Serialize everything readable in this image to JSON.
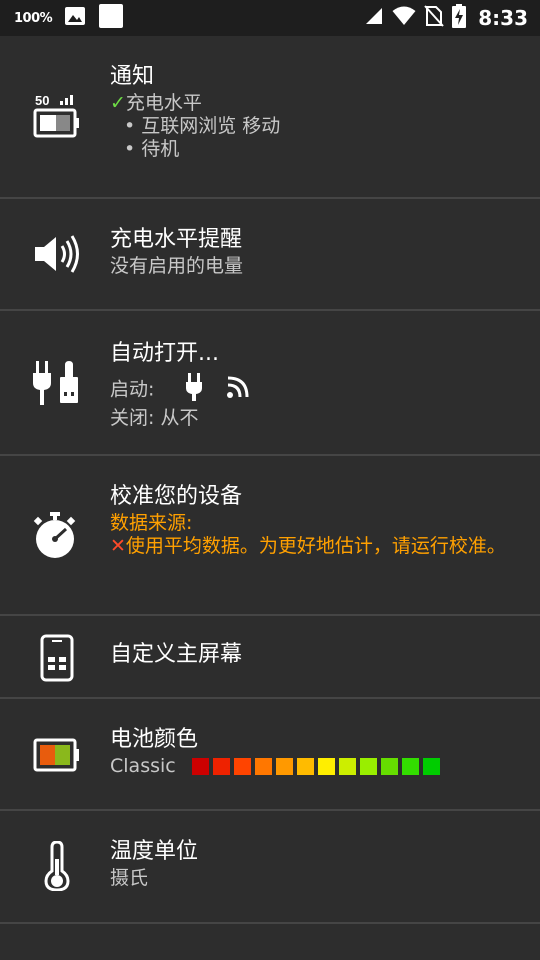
{
  "status_bar": {
    "battery_percent": "100%",
    "time": "8:33",
    "icons": [
      "image-icon",
      "square-app-icon",
      "signal-icon",
      "wifi-icon",
      "no-sim-icon",
      "battery-charging-icon"
    ]
  },
  "settings": [
    {
      "id": "notification",
      "icon": "battery-signal-icon",
      "title": "通知",
      "check_item": "充电水平",
      "bullets": [
        "互联网浏览 移动",
        "待机"
      ]
    },
    {
      "id": "charge-reminder",
      "icon": "speaker-icon",
      "title": "充电水平提醒",
      "subtitle": "没有启用的电量"
    },
    {
      "id": "auto-open",
      "icon": "plug-usb-icon",
      "title": "自动打开...",
      "on_label": "启动:",
      "off_label": "关闭: 从不",
      "on_icons": [
        "plug-icon",
        "wireless-icon"
      ]
    },
    {
      "id": "calibrate",
      "icon": "stopwatch-icon",
      "title": "校准您的设备",
      "data_source_label": "数据来源:",
      "cross_mark": "✕",
      "data_source_text": "使用平均数据。为更好地估计，请运行校准。"
    },
    {
      "id": "home-screen",
      "icon": "phone-widget-icon",
      "title": "自定义主屏幕"
    },
    {
      "id": "battery-color",
      "icon": "battery-color-icon",
      "title": "电池颜色",
      "subtitle": "Classic",
      "swatches": [
        "#cc0000",
        "#ee2200",
        "#ff4400",
        "#ff7700",
        "#ff9900",
        "#ffbb00",
        "#ffee00",
        "#ccee00",
        "#99ee00",
        "#66dd00",
        "#33dd00",
        "#00cc00"
      ]
    },
    {
      "id": "temperature-unit",
      "icon": "thermometer-icon",
      "title": "温度单位",
      "subtitle": "摄氏"
    }
  ],
  "colors": {
    "background": "#2d2d2d",
    "divider": "#454545",
    "accent_orange": "#ffa000",
    "check_green": "#6ddc45",
    "cross_red": "#ff4a2a"
  }
}
